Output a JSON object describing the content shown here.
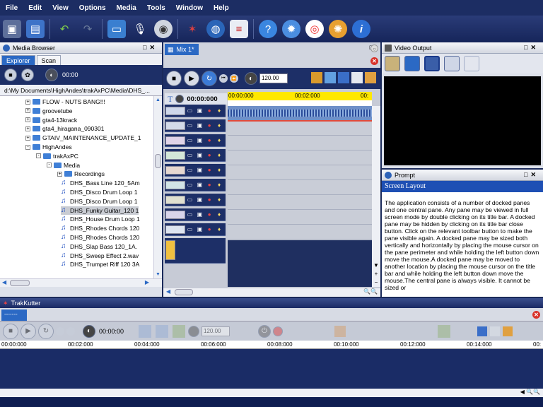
{
  "menu": [
    "File",
    "Edit",
    "View",
    "Options",
    "Media",
    "Tools",
    "Window",
    "Help"
  ],
  "toolbar_icons": [
    "save-icon",
    "open-folder-icon",
    "undo-icon",
    "redo-icon",
    "monitor-icon",
    "microphone-icon",
    "cd-icon",
    "star-burst-icon",
    "globe-icon",
    "equalizer-icon",
    "help-bubble-icon",
    "network-icon",
    "lifebuoy-icon",
    "gear-settings-icon",
    "info-icon"
  ],
  "media_browser": {
    "title": "Media Browser",
    "tabs": [
      "Explorer",
      "Scan"
    ],
    "time": "00:00",
    "path": "d:\\My Documents\\HighAndes\\trakAxPC\\Media\\DHS_...",
    "tree": [
      {
        "label": "FLOW - NUTS BANG!!!",
        "type": "folder",
        "level": 0,
        "exp": "+"
      },
      {
        "label": "groovetube",
        "type": "folder",
        "level": 0,
        "exp": "+"
      },
      {
        "label": "gta4-13krack",
        "type": "folder",
        "level": 0,
        "exp": "+"
      },
      {
        "label": "gta4_hiragana_090301",
        "type": "folder",
        "level": 0,
        "exp": "+"
      },
      {
        "label": "GTAIV_MAINTENANCE_UPDATE_1",
        "type": "folder",
        "level": 0,
        "exp": "+"
      },
      {
        "label": "HighAndes",
        "type": "folder",
        "level": 0,
        "exp": "-"
      },
      {
        "label": "trakAxPC",
        "type": "folder",
        "level": 1,
        "exp": "-"
      },
      {
        "label": "Media",
        "type": "folder",
        "level": 2,
        "exp": "-"
      },
      {
        "label": "Recordings",
        "type": "folder",
        "level": 3,
        "exp": "+"
      },
      {
        "label": "DHS_Bass Line 120_5Am",
        "type": "file",
        "level": 3
      },
      {
        "label": "DHS_Disco Drum Loop 1",
        "type": "file",
        "level": 3
      },
      {
        "label": "DHS_Disco Drum Loop 1",
        "type": "file",
        "level": 3
      },
      {
        "label": "DHS_Funky Guitar_120 1",
        "type": "file",
        "level": 3,
        "selected": true
      },
      {
        "label": "DHS_House Drum Loop 1",
        "type": "file",
        "level": 3
      },
      {
        "label": "DHS_Rhodes Chords 120",
        "type": "file",
        "level": 3
      },
      {
        "label": "DHS_Rhodes Chords 120",
        "type": "file",
        "level": 3
      },
      {
        "label": "DHS_Slap Bass 120_1A.",
        "type": "file",
        "level": 3
      },
      {
        "label": "DHS_Sweep Effect 2.wav",
        "type": "file",
        "level": 3
      },
      {
        "label": "DHS_Trumpet Riff 120 3A",
        "type": "file",
        "level": 3
      }
    ]
  },
  "mix": {
    "title": "Mix 1*",
    "tempo": "120.00",
    "position": "00:00:000",
    "ruler": [
      "00:00:000",
      "00:02:000",
      "00:"
    ],
    "track_count": 9
  },
  "video": {
    "title": "Video Output"
  },
  "prompt": {
    "title": "Prompt",
    "heading": "Screen Layout",
    "body": "The application consists of a number of docked panes and one central pane. Any pane may be viewed in full screen mode by double clicking on its title bar. A docked pane may be hidden by clicking on its title bar close button. Click on the relevant toolbar button to make the pane visible again. A docked pane may be sized both vertically and horizontally by placing the mouse cursor on the pane perimeter and while holding the left button down move the mouse.A docked pane may be moved to another location by placing the mouse cursor on the title bar and while holding the left button down move the mouse.The central pane is always visible. It cannot be sized or"
  },
  "trakkutter": {
    "title": "TrakKutter",
    "tab": "-------",
    "time": "00:00:00",
    "tempo": "120.00",
    "ruler": [
      "00:00:000",
      "00:02:000",
      "00:04:000",
      "00:06:000",
      "00:08:000",
      "00:10:000",
      "00:12:000",
      "00:14:000",
      "00:"
    ]
  },
  "colors": {
    "accent": "#2b69c4",
    "dark": "#1d2f67",
    "menubar": "#1c2d63",
    "timeline": "#ffe800"
  }
}
